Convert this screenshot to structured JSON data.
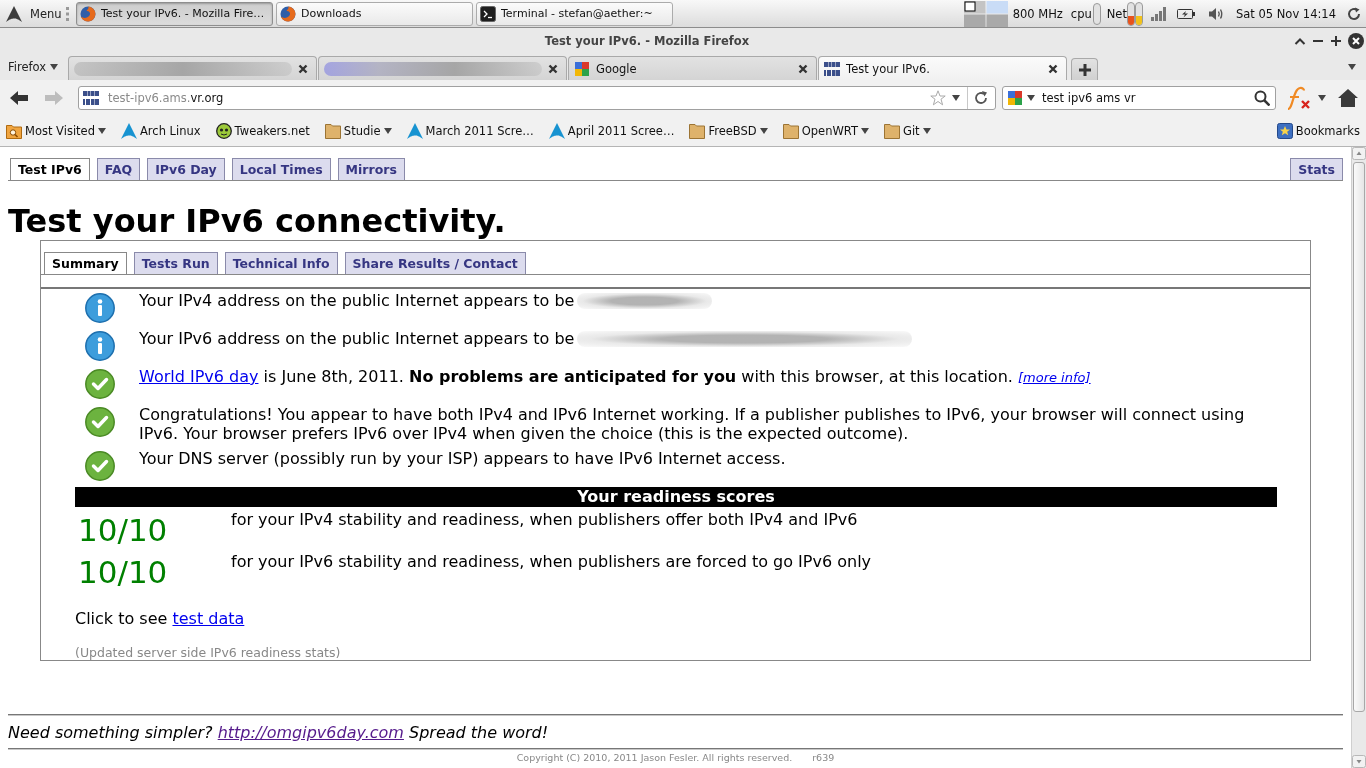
{
  "panel": {
    "menu_label": "Menu",
    "tasks": [
      {
        "kind": "browser",
        "title": "Test your IPv6. - Mozilla Fire…",
        "selected": true
      },
      {
        "kind": "browser",
        "title": "Downloads",
        "selected": false
      },
      {
        "kind": "terminal",
        "title": "Terminal - stefan@aether:~",
        "selected": false
      }
    ],
    "cpu_frequency": "800 MHz",
    "cpu_label": "cpu",
    "net_label": "Net",
    "clock": "Sat 05 Nov 14:14"
  },
  "window": {
    "title": "Test your IPv6. - Mozilla Firefox"
  },
  "browser": {
    "menu_button": "Firefox",
    "tabs": [
      {
        "kind": "redacted",
        "selected": false
      },
      {
        "kind": "redacted",
        "selected": false
      },
      {
        "kind": "blocks",
        "title": "Google",
        "selected": false
      },
      {
        "kind": "site",
        "title": "Test your IPv6.",
        "selected": true
      }
    ],
    "nav_buttons": [
      {
        "kind": "back",
        "disabled": false
      },
      {
        "kind": "forward",
        "disabled": true
      }
    ],
    "url": {
      "host_prefix": "test-ipv6.ams.",
      "domain": "vr.org",
      "starred": false
    },
    "search": {
      "value": "test ipv6 ams vr"
    },
    "bookmarks": [
      {
        "kind": "smart",
        "label": "Most Visited",
        "dropdown": true
      },
      {
        "kind": "arch",
        "label": "Arch Linux",
        "dropdown": false
      },
      {
        "kind": "smiley",
        "label": "Tweakers.net",
        "dropdown": false
      },
      {
        "kind": "folder",
        "label": "Studie",
        "dropdown": true
      },
      {
        "kind": "arch",
        "label": "March 2011 Scre…",
        "dropdown": false
      },
      {
        "kind": "arch",
        "label": "April 2011 Scree…",
        "dropdown": false
      },
      {
        "kind": "folder",
        "label": "FreeBSD",
        "dropdown": true
      },
      {
        "kind": "folder",
        "label": "OpenWRT",
        "dropdown": true
      },
      {
        "kind": "folder",
        "label": "Git",
        "dropdown": true
      }
    ],
    "bookmarks_menu": "Bookmarks"
  },
  "page": {
    "nav_tabs": [
      {
        "label": "Test IPv6",
        "selected": true
      },
      {
        "label": "FAQ",
        "selected": false
      },
      {
        "label": "IPv6 Day",
        "selected": false
      },
      {
        "label": "Local Times",
        "selected": false
      },
      {
        "label": "Mirrors",
        "selected": false
      }
    ],
    "nav_tabs_right": [
      {
        "label": "Stats",
        "selected": false
      }
    ],
    "heading": "Test your IPv6 connectivity.",
    "sub_tabs": [
      {
        "label": "Summary",
        "selected": true
      },
      {
        "label": "Tests Run",
        "selected": false
      },
      {
        "label": "Technical Info",
        "selected": false
      },
      {
        "label": "Share Results / Contact",
        "selected": false
      }
    ],
    "messages": [
      {
        "kind": "info",
        "parts": [
          {
            "kind": "text",
            "text": "Your IPv4 address on the public Internet appears to be"
          },
          {
            "kind": "blurred_short"
          }
        ]
      },
      {
        "kind": "info",
        "parts": [
          {
            "kind": "text",
            "text": "Your IPv6 address on the public Internet appears to be"
          },
          {
            "kind": "blurred_long"
          }
        ]
      },
      {
        "kind": "ok",
        "parts": [
          {
            "kind": "link",
            "text": "World IPv6 day"
          },
          {
            "kind": "text",
            "text": " is June 8th, 2011. **No problems are anticipated for you** with this browser, at this location. "
          },
          {
            "kind": "note_link",
            "text": "[more info]"
          }
        ]
      },
      {
        "kind": "ok",
        "parts": [
          {
            "kind": "text",
            "text": "Congratulations! You appear to have both IPv4 and IPv6 Internet working. If a publisher publishes to IPv6, your browser will connect using IPv6. Your browser prefers IPv6 over IPv4 when given the choice (this is the expected outcome)."
          }
        ]
      },
      {
        "kind": "ok",
        "parts": [
          {
            "kind": "text",
            "text": "Your DNS server (possibly run by your ISP) appears to have IPv6 Internet access."
          }
        ]
      }
    ],
    "readiness_title": "Your readiness scores",
    "scores": [
      {
        "score": "10/10",
        "text": "for your IPv4 stability and readiness, when publishers offer both IPv4 and IPv6"
      },
      {
        "score": "10/10",
        "text": "for your IPv6 stability and readiness, when publishers are forced to go IPv6 only"
      }
    ],
    "test_data": {
      "prefix": "Click to see",
      "link": "test data"
    },
    "stats_note": "(Updated server side IPv6 readiness stats)",
    "footer": {
      "before": "Need something simpler?",
      "link": "http://omgipv6day.com",
      "after": "Spread the word!"
    },
    "copyright": "Copyright (C) 2010, 2011 Jason Fesler. All rights reserved.",
    "revision": "r639"
  }
}
